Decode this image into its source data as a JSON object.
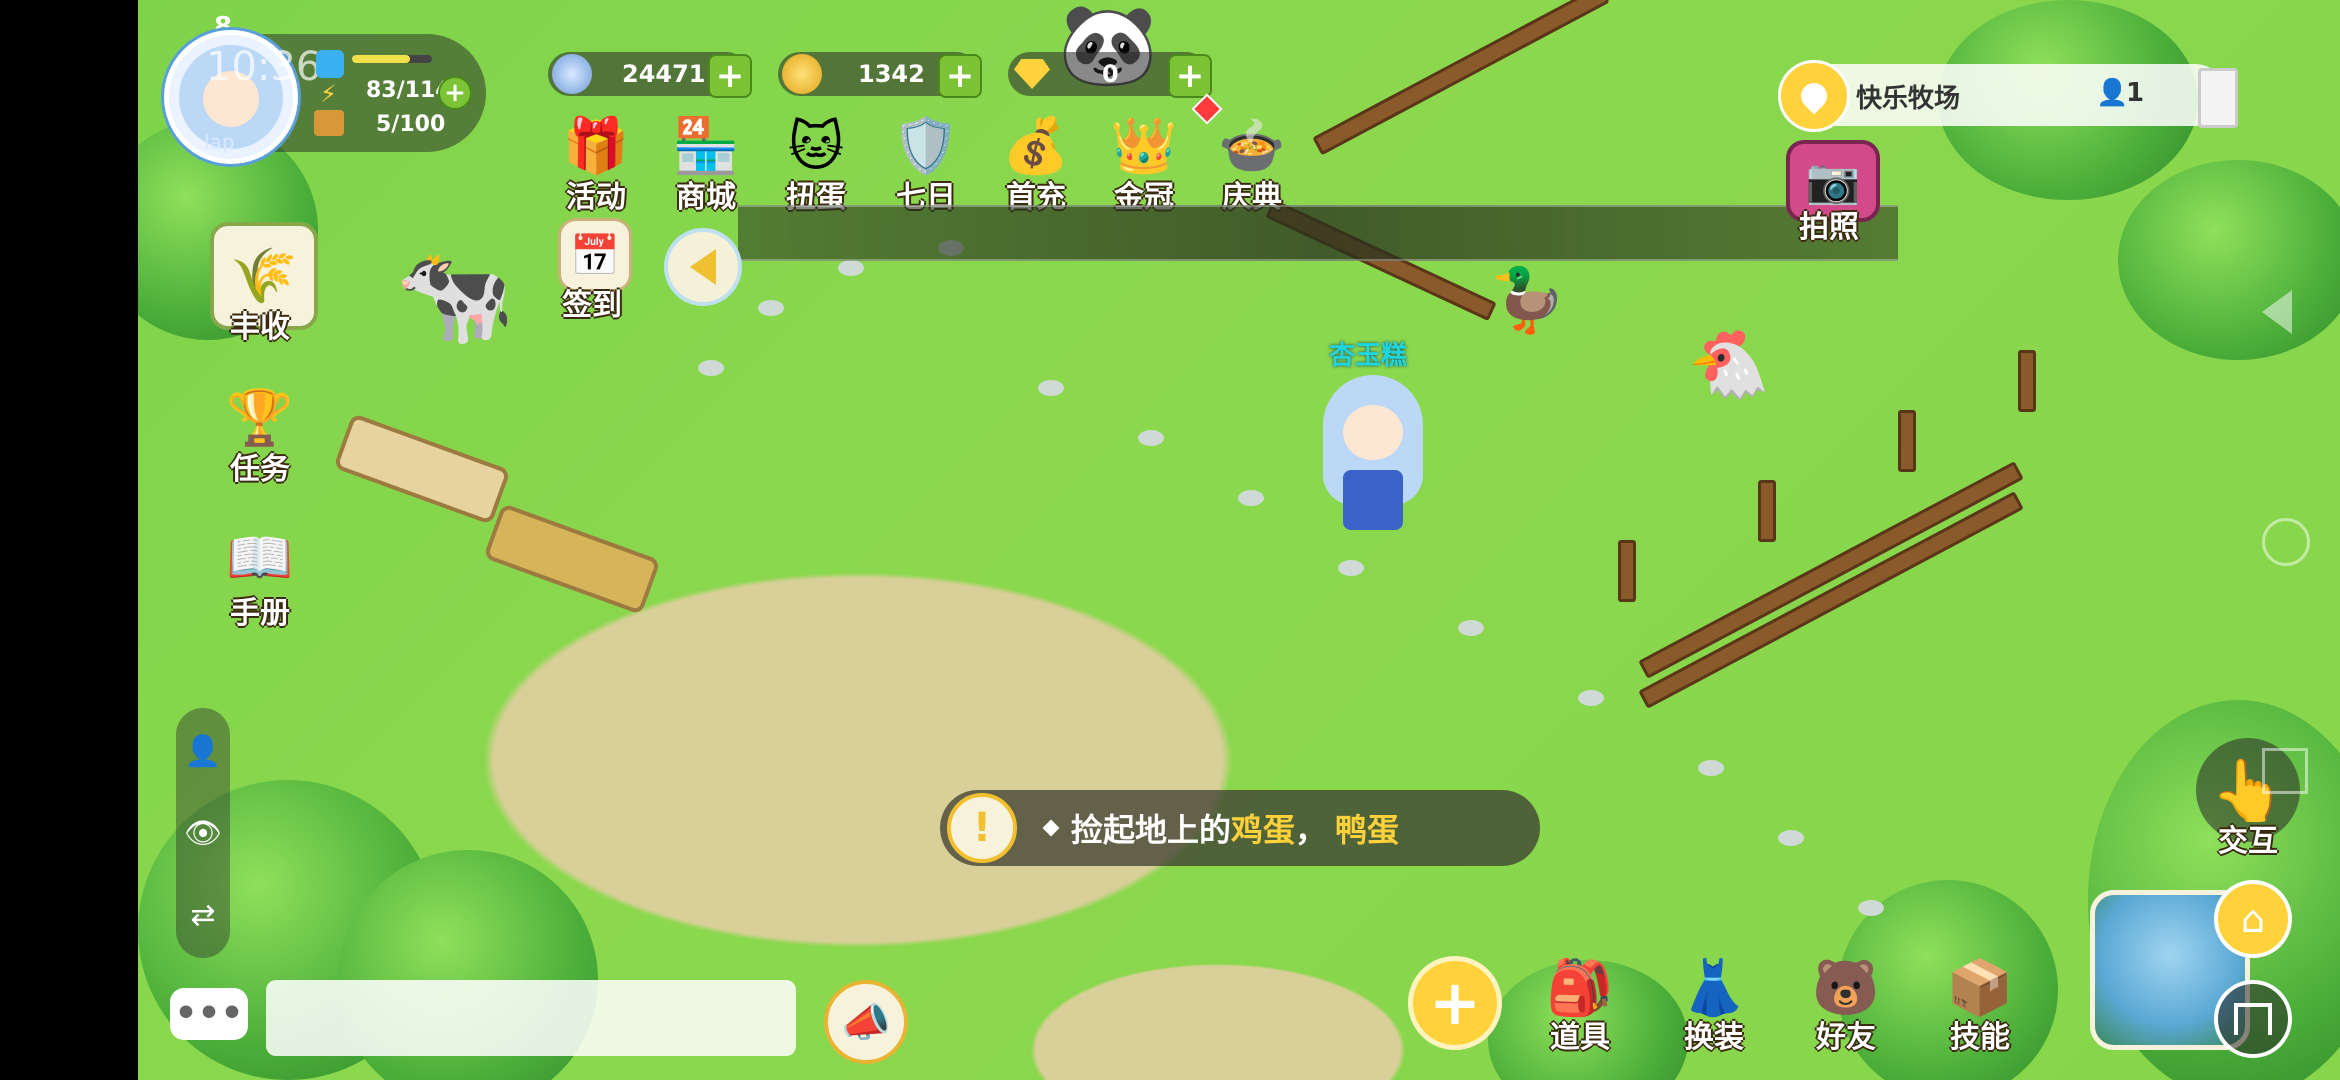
{
  "status": {
    "time": "10:36",
    "level": "8"
  },
  "player": {
    "avatar_label": "lap",
    "stamina": "83/114",
    "storage": "5/100",
    "character_name": "杏玉糕"
  },
  "currency": {
    "gems_blue": "24471",
    "coins": "1342",
    "diamonds": "0"
  },
  "top_menu": [
    {
      "label": "活动",
      "icon": "gift-bear-icon"
    },
    {
      "label": "商城",
      "icon": "shop-icon"
    },
    {
      "label": "扭蛋",
      "icon": "gacha-cat-icon"
    },
    {
      "label": "七日",
      "icon": "seven-day-shield-icon"
    },
    {
      "label": "首充",
      "icon": "first-recharge-icon"
    },
    {
      "label": "金冠",
      "icon": "gold-crown-icon"
    },
    {
      "label": "庆典",
      "icon": "celebration-bowl-icon"
    }
  ],
  "checkin": {
    "label": "签到"
  },
  "left_menu": [
    {
      "label": "丰收",
      "icon": "harvest-icon"
    },
    {
      "label": "任务",
      "icon": "task-trophy-icon"
    },
    {
      "label": "手册",
      "icon": "handbook-icon"
    }
  ],
  "location": {
    "name": "快乐牧场",
    "players": "1"
  },
  "photo": {
    "label": "拍照"
  },
  "quest": {
    "prefix": "捡起地上的",
    "egg": "鸡蛋",
    "sep": "，",
    "duck_egg": "鸭蛋"
  },
  "bottom_menu": [
    {
      "label": "道具",
      "icon": "items-icon"
    },
    {
      "label": "换装",
      "icon": "dressup-icon"
    },
    {
      "label": "好友",
      "icon": "friends-icon"
    },
    {
      "label": "技能",
      "icon": "skills-icon"
    }
  ],
  "interact": {
    "label": "交互"
  },
  "colors": {
    "highlight": "#ffd23c",
    "plus_green": "#7cc436"
  }
}
